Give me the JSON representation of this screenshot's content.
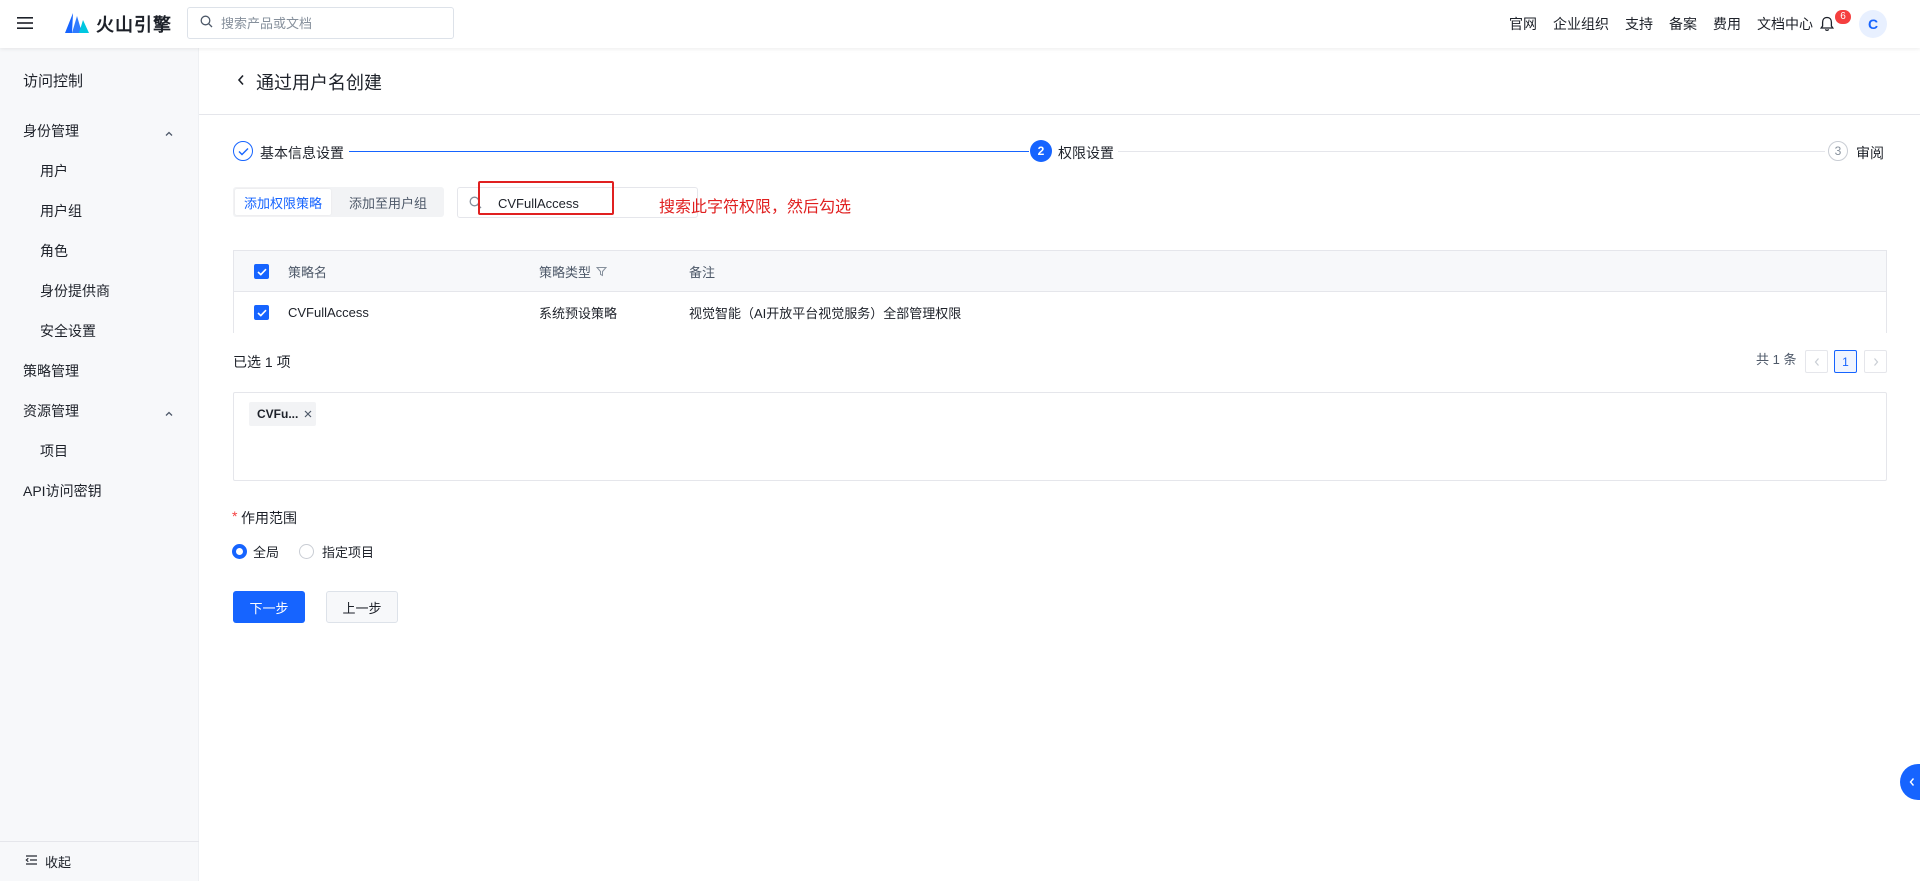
{
  "header": {
    "logo_text": "火山引擎",
    "search_placeholder": "搜索产品或文档",
    "nav": [
      "官网",
      "企业组织",
      "支持",
      "备案",
      "费用",
      "文档中心"
    ],
    "notification_count": "6",
    "avatar": "C",
    "icons": [
      "menu-icon",
      "logo-icon",
      "search-icon",
      "bell-icon"
    ]
  },
  "sidebar": {
    "title": "访问控制",
    "items": [
      {
        "label": "身份管理",
        "expanded": true
      },
      {
        "label": "用户"
      },
      {
        "label": "用户组"
      },
      {
        "label": "角色"
      },
      {
        "label": "身份提供商"
      },
      {
        "label": "安全设置"
      },
      {
        "label": "策略管理"
      },
      {
        "label": "资源管理",
        "expanded": true
      },
      {
        "label": "项目"
      },
      {
        "label": "API访问密钥"
      }
    ],
    "collapse_label": "收起"
  },
  "page": {
    "title": "通过用户名创建"
  },
  "steps": [
    {
      "label": "基本信息设置",
      "completed": true
    },
    {
      "number": "2",
      "label": "权限设置",
      "active": true
    },
    {
      "number": "3",
      "label": "审阅"
    }
  ],
  "tabs": [
    {
      "label": "添加权限策略",
      "active": true
    },
    {
      "label": "添加至用户组",
      "active": false
    }
  ],
  "search": {
    "value": "CVFullAccess"
  },
  "annotation": {
    "text": "搜索此字符权限，然后勾选",
    "color": "#e02020"
  },
  "table": {
    "columns": [
      "策略名",
      "策略类型",
      "备注"
    ],
    "header_checked": true,
    "rows": [
      {
        "name": "CVFullAccess",
        "type": "系统预设策略",
        "note": "视觉智能（AI开放平台视觉服务）全部管理权限",
        "checked": true
      }
    ]
  },
  "selection": {
    "summary": "已选 1 项",
    "tags": [
      "CVFu..."
    ]
  },
  "pagination": {
    "total": "共 1 条",
    "current": "1"
  },
  "scope": {
    "required_mark": "*",
    "label": "作用范围",
    "options": [
      {
        "label": "全局",
        "selected": true
      },
      {
        "label": "指定项目",
        "selected": false
      }
    ]
  },
  "actions": {
    "next": "下一步",
    "prev": "上一步"
  },
  "colors": {
    "primary": "#1664ff",
    "annotation": "#e02020",
    "badge": "#f53f3f"
  }
}
